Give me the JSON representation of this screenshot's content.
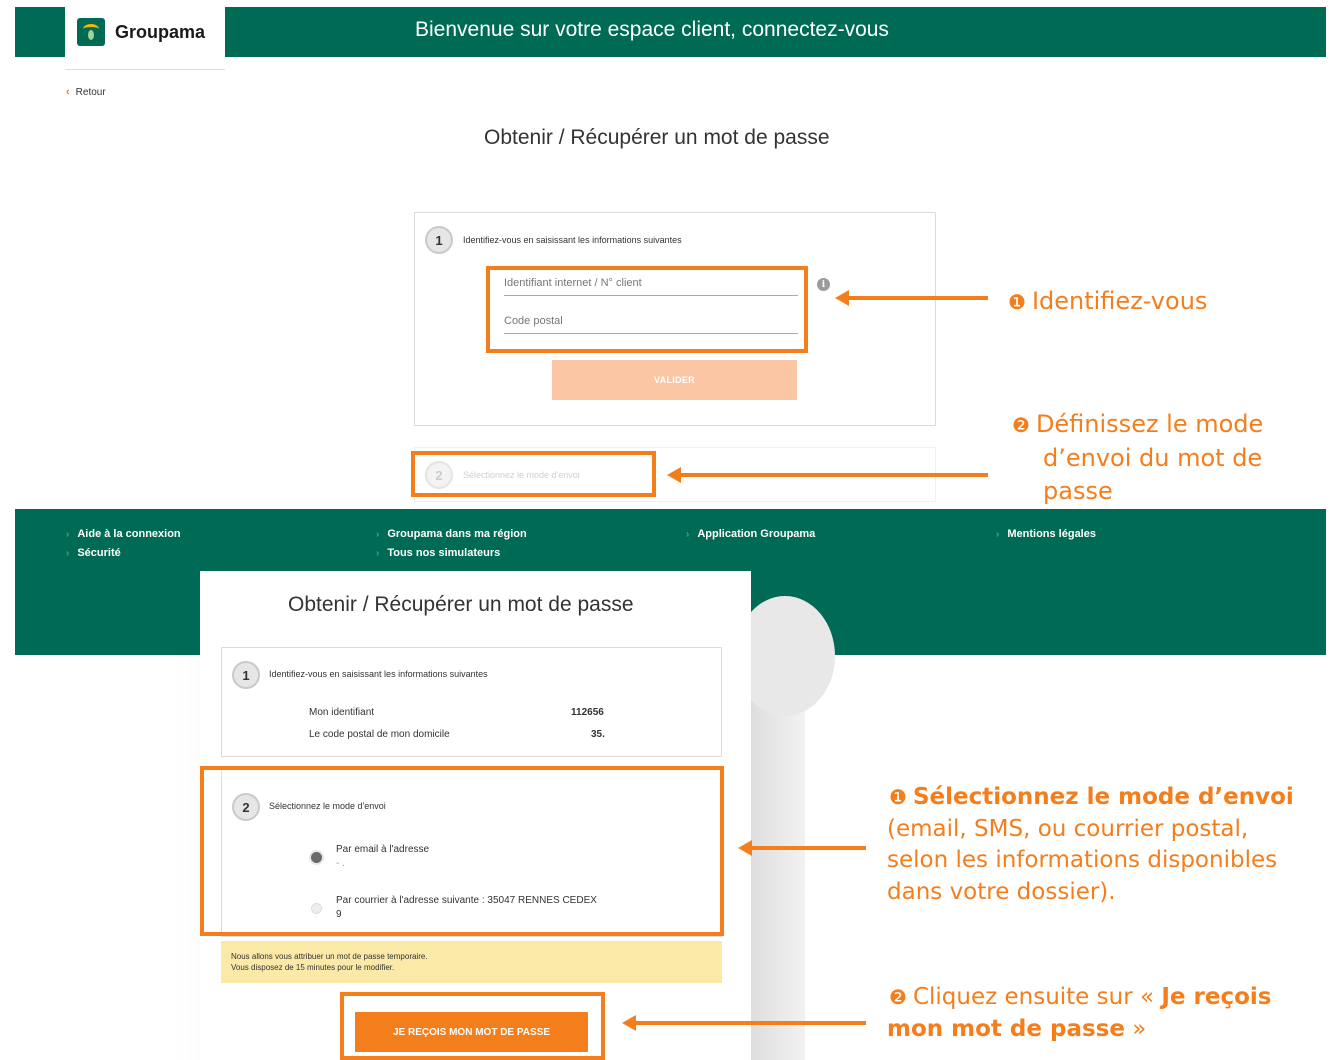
{
  "header": {
    "brand": "Groupama",
    "title": "Bienvenue sur votre espace client, connectez-vous"
  },
  "nav": {
    "back_label": "Retour"
  },
  "form_top": {
    "title": "Obtenir / Récupérer un mot de passe",
    "step1": {
      "number": "1",
      "label": "Identifiez-vous en saisissant les informations suivantes",
      "id_placeholder": "Identifiant internet / N° client",
      "postal_placeholder": "Code postal",
      "info_glyph": "i",
      "submit_label": "VALIDER"
    },
    "step2": {
      "number": "2",
      "label": "Sélectionnez le mode d'envoi"
    }
  },
  "annotations_top": {
    "a1_marker": "❶",
    "a1_text": "Identifiez-vous",
    "a2_marker": "❷",
    "a2_line1": "Définissez  le mode",
    "a2_line2": "d’envoi du mot de",
    "a2_line3": "passe"
  },
  "footer": {
    "col1": [
      "Aide à la connexion",
      "Sécurité"
    ],
    "col2": [
      "Groupama dans ma région",
      "Tous nos simulateurs"
    ],
    "col3": [
      "Application Groupama"
    ],
    "col4": [
      "Mentions légales"
    ]
  },
  "form_bottom": {
    "title": "Obtenir / Récupérer un mot de passe",
    "step1": {
      "number": "1",
      "label": "Identifiez-vous en saisissant les informations suivantes",
      "id_label": "Mon identifiant",
      "id_value": "112656",
      "postal_label": "Le code postal de mon domicile",
      "postal_value": "35."
    },
    "step2": {
      "number": "2",
      "label": "Sélectionnez le mode d'envoi",
      "option_email": "Par email à l'adresse",
      "option_email_sub": "-                    .",
      "option_mail": "Par courrier à l'adresse suivante : 35047 RENNES CEDEX",
      "option_mail_sub": "9"
    },
    "notice_line1": "Nous allons vous attribuer un mot de passe temporaire.",
    "notice_line2": "Vous disposez de 15 minutes pour le modifier.",
    "cta_label": "JE REÇOIS MON MOT DE PASSE"
  },
  "annotations_bottom": {
    "b1_marker": "❶",
    "b1_bold": "Sélectionnez le mode d’envoi",
    "b1_rest": "(email, SMS, ou courrier postal, selon les informations disponibles dans votre dossier).",
    "b2_marker": "❷",
    "b2_pre": "Cliquez ensuite sur «",
    "b2_bold": "Je reçois mon mot de passe",
    "b2_post": "»"
  },
  "colors": {
    "brand_green": "#006b55",
    "accent_orange": "#f57e1c",
    "disabled_button": "#fbc6a4",
    "notice_yellow": "#fbe9a8"
  }
}
